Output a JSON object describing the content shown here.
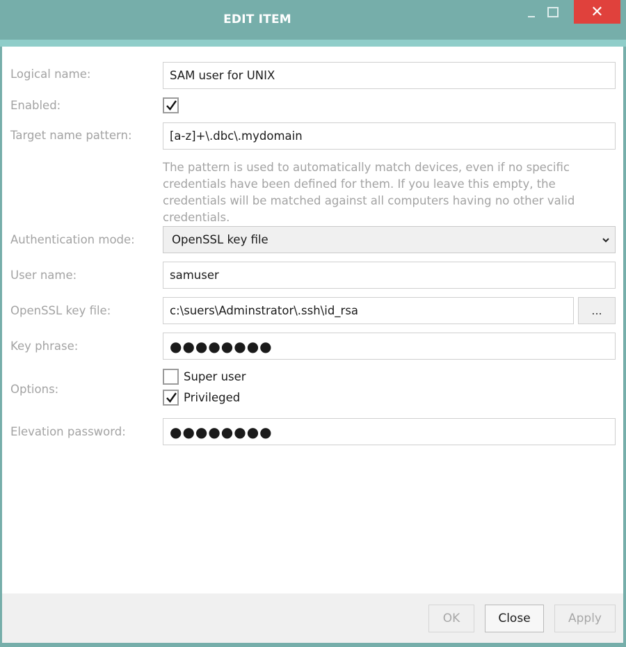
{
  "window": {
    "title": "EDIT ITEM",
    "close_glyph": "✕"
  },
  "form": {
    "logical_name": {
      "label": "Logical name:",
      "value": "SAM user for UNIX"
    },
    "enabled": {
      "label": "Enabled:",
      "checked": true
    },
    "target_pattern": {
      "label": "Target name pattern:",
      "value": "[a-z]+\\.dbc\\.mydomain"
    },
    "hint": "The pattern is used to automatically match devices, even if no specific credentials have been defined for them. If you leave this empty, the credentials will be matched against all computers having no other valid credentials.",
    "auth_mode": {
      "label": "Authentication mode:",
      "value": "OpenSSL key file"
    },
    "user_name": {
      "label": "User name:",
      "value": "samuser"
    },
    "key_file": {
      "label": "OpenSSL key file:",
      "value": "c:\\suers\\Adminstrator\\.ssh\\id_rsa",
      "browse_label": "..."
    },
    "key_phrase": {
      "label": "Key phrase:",
      "value": "●●●●●●●●"
    },
    "options": {
      "label": "Options:",
      "super_user": {
        "label": "Super user",
        "checked": false
      },
      "privileged": {
        "label": "Privileged",
        "checked": true
      }
    },
    "elevation_password": {
      "label": "Elevation password:",
      "value": "●●●●●●●●"
    }
  },
  "buttons": {
    "ok": "OK",
    "close": "Close",
    "apply": "Apply"
  },
  "colors": {
    "titlebar": "#76aeaa",
    "accent": "#8fcdc9",
    "close_button": "#e0413c"
  }
}
